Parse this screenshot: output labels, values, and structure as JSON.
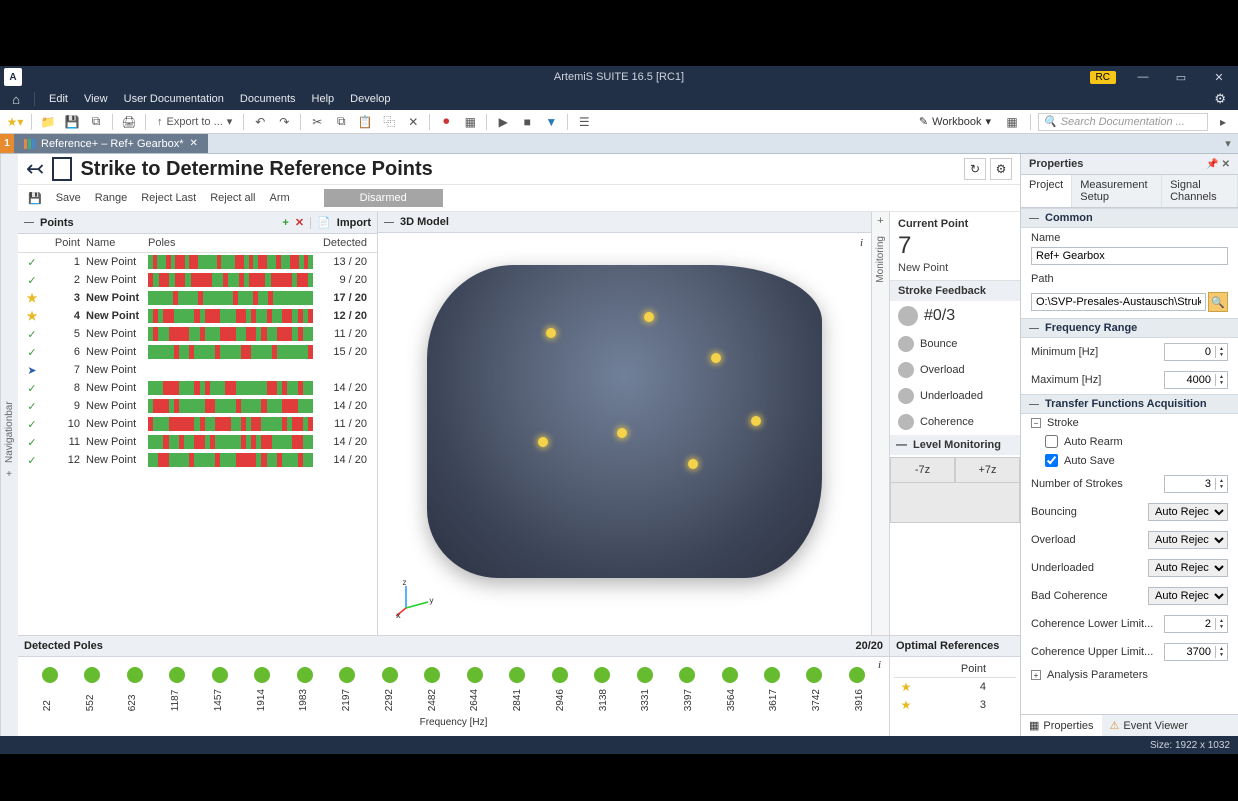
{
  "titlebar": {
    "title": "ArtemiS SUITE 16.5 [RC1]",
    "rc": "RC"
  },
  "menus": [
    "Edit",
    "View",
    "User Documentation",
    "Documents",
    "Help",
    "Develop"
  ],
  "toolbar": {
    "export": "Export to ...",
    "workbook": "Workbook",
    "search_placeholder": "Search Documentation ..."
  },
  "doctab": {
    "index": "1",
    "label": "Reference+ – Ref+ Gearbox*"
  },
  "header": {
    "title": "Strike to Determine Reference Points"
  },
  "actions": {
    "save": "Save",
    "range": "Range",
    "rejectLast": "Reject Last",
    "rejectAll": "Reject all",
    "arm": "Arm",
    "disarmed": "Disarmed"
  },
  "navbar_label": "Navigationbar",
  "monitor_label": "Monitoring",
  "points_panel": {
    "title": "Points",
    "import": "Import",
    "cols": {
      "point": "Point",
      "name": "Name",
      "poles": "Poles",
      "detected": "Detected"
    }
  },
  "points": [
    {
      "icon": "check",
      "pt": 1,
      "name": "New Point",
      "det": "13 / 20",
      "poles": "grggrgrrgrrggggrgggrrgrgrrggrggrrgrg"
    },
    {
      "icon": "check",
      "pt": 2,
      "name": "New Point",
      "det": "9 / 20",
      "poles": "rgrrgrrgrrrrggrggrgrrrgrrrrgrrg"
    },
    {
      "icon": "star",
      "pt": 3,
      "name": "New Point",
      "det": "17 / 20",
      "poles": "gggggrggggrggggggrgggrggrgggggggg",
      "sel": true
    },
    {
      "icon": "star",
      "pt": 4,
      "name": "New Point",
      "det": "12 / 20",
      "poles": "grgrrggggrgrrrgggrrgrggrggrrgrgr",
      "sel": true
    },
    {
      "icon": "check",
      "pt": 5,
      "name": "New Point",
      "det": "11 / 20",
      "poles": "grggrrrrggrgggrrrggrrgrggrrrgrgg"
    },
    {
      "icon": "check",
      "pt": 6,
      "name": "New Point",
      "det": "15 / 20",
      "poles": "gggggrggrggggrggggrrggggrggggggr"
    },
    {
      "icon": "arrow",
      "pt": 7,
      "name": "New Point",
      "det": "",
      "poles": ""
    },
    {
      "icon": "check",
      "pt": 8,
      "name": "New Point",
      "det": "14 / 20",
      "poles": "gggrrrgggrgrgggrrggggggrrgrggrgg"
    },
    {
      "icon": "check",
      "pt": 9,
      "name": "New Point",
      "det": "14 / 20",
      "poles": "grrrgrgggggrrggggrggggrgggrrrggg"
    },
    {
      "icon": "check",
      "pt": 10,
      "name": "New Point",
      "det": "11 / 20",
      "poles": "rgggrrrrrgrggrrrggrgrrggggrgrrgr"
    },
    {
      "icon": "check",
      "pt": 11,
      "name": "New Point",
      "det": "14 / 20",
      "poles": "gggrggrggrrgrgggggrgrgrrggggrrgg"
    },
    {
      "icon": "check",
      "pt": 12,
      "name": "New Point",
      "det": "14 / 20",
      "poles": "ggrrggggrggggrgggrrrrgrggrgggrgg"
    }
  ],
  "model_panel": {
    "title": "3D Model"
  },
  "current": {
    "title": "Current Point",
    "num": "7",
    "name": "New Point"
  },
  "stroke": {
    "title": "Stroke Feedback",
    "count": "#0/3",
    "items": [
      "Bounce",
      "Overload",
      "Underloaded",
      "Coherence"
    ]
  },
  "level": {
    "title": "Level Monitoring",
    "neg": "-7z",
    "pos": "+7z"
  },
  "detected": {
    "title": "Detected Poles",
    "count": "20/20",
    "axis": "Frequency [Hz]",
    "freqs": [
      "22",
      "552",
      "623",
      "1187",
      "1457",
      "1914",
      "1983",
      "2197",
      "2292",
      "2482",
      "2644",
      "2841",
      "2946",
      "3138",
      "3331",
      "3397",
      "3564",
      "3617",
      "3742",
      "3916"
    ]
  },
  "optref": {
    "title": "Optimal References",
    "col": "Point",
    "rows": [
      {
        "pt": "4"
      },
      {
        "pt": "3"
      }
    ]
  },
  "props": {
    "title": "Properties",
    "tabs": [
      "Project",
      "Measurement Setup",
      "Signal Channels"
    ],
    "common": "Common",
    "name_label": "Name",
    "name": "Ref+ Gearbox",
    "path_label": "Path",
    "path": "O:\\SVP-Presales-Austausch\\Strukturdyna",
    "freq_title": "Frequency Range",
    "min_label": "Minimum [Hz]",
    "min": "0",
    "max_label": "Maximum [Hz]",
    "max": "4000",
    "tfa_title": "Transfer Functions Acquisition",
    "stroke_label": "Stroke",
    "auto_rearm": "Auto Rearm",
    "auto_save": "Auto Save",
    "num_strokes_label": "Number of Strokes",
    "num_strokes": "3",
    "bouncing": "Bouncing",
    "overload": "Overload",
    "underloaded": "Underloaded",
    "bad_coh": "Bad Coherence",
    "auto_reject": "Auto Reject",
    "coh_lower_label": "Coherence Lower Limit...",
    "coh_lower": "2",
    "coh_upper_label": "Coherence Upper Limit...",
    "coh_upper": "3700",
    "analysis_params": "Analysis Parameters",
    "footer_props": "Properties",
    "footer_event": "Event Viewer"
  },
  "status": {
    "size": "Size: 1922 x 1032"
  }
}
